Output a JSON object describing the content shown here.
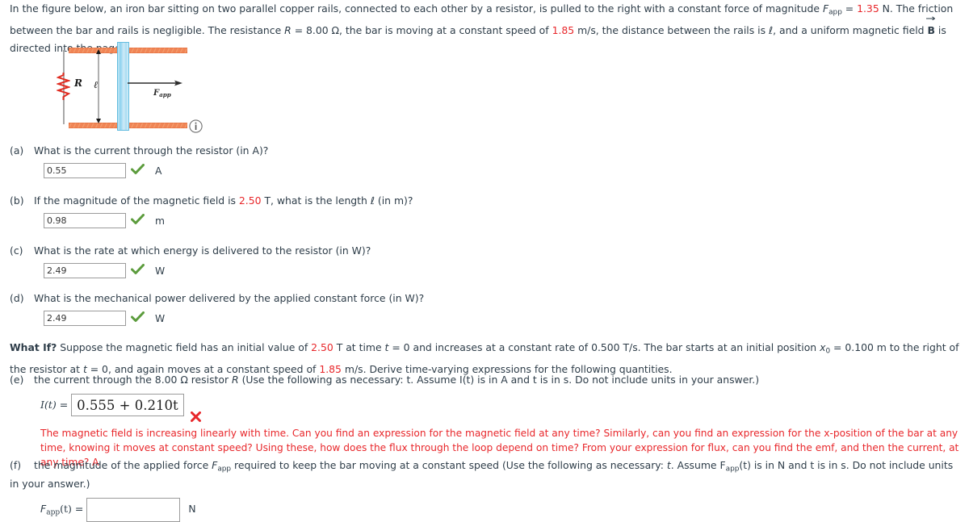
{
  "problem": {
    "intro_part1": "In the figure below, an iron bar sitting on two parallel copper rails, connected to each other by a resistor, is pulled to the right with a constant force of magnitude ",
    "intro_fapp_symbol": "F",
    "intro_fapp_sub": "app",
    "intro_eq": " = ",
    "force_value": "1.35",
    "intro_part2": " N. The friction between the bar and rails is negligible. The resistance ",
    "resistance_symbol": "R",
    "resistance_value": " = 8.00 Ω",
    "intro_part3": ", the bar is moving at a constant speed of ",
    "speed_value": "1.85",
    "intro_part4": " m/s, the distance between the rails is ",
    "ell_symbol": "ℓ",
    "intro_part5": ", and a uniform magnetic field ",
    "field_symbol": "B",
    "intro_part6": " is directed into the page."
  },
  "figure": {
    "resistor_label": "R",
    "length_label": "ℓ",
    "force_label_symbol": "F",
    "force_label_sub": "app",
    "info_icon_label": "i",
    "rail_color": "#ef7f4e",
    "bar_color": "#8fd3ef",
    "resistor_color": "#e02b20",
    "wire_color": "#9e9e9e"
  },
  "questions": [
    {
      "tag": "(a)",
      "text": "What is the current through the resistor (in A)?",
      "value": "0.55",
      "unit": "A",
      "status": "correct"
    },
    {
      "tag": "(b)",
      "text_pre": "If the magnitude of the magnetic field is ",
      "highlight": "2.50",
      "text_post": " T, what is the length ℓ (in m)?",
      "value": "0.98",
      "unit": "m",
      "status": "correct"
    },
    {
      "tag": "(c)",
      "text": "What is the rate at which energy is delivered to the resistor (in W)?",
      "value": "2.49",
      "unit": "W",
      "status": "correct"
    },
    {
      "tag": "(d)",
      "text": "What is the mechanical power delivered by the applied constant force (in W)?",
      "value": "2.49",
      "unit": "W",
      "status": "correct"
    }
  ],
  "what_if": {
    "label": "What If?",
    "part1": " Suppose the magnetic field has an initial value of ",
    "field_initial": "2.50",
    "part2": " T at time ",
    "t_symbol": "t",
    "part3": " = 0 and increases at a constant rate of 0.500 T/s. The bar starts at an initial position ",
    "x0_symbol": "x",
    "x0_sub": "0",
    "part4": " = 0.100 m to the right of the resistor at ",
    "part5": " = 0, and again moves at a constant speed of ",
    "speed": "1.85",
    "part6": " m/s. Derive time-varying expressions for the following quantities."
  },
  "part_e": {
    "tag": "(e)",
    "text_pre": "the current through the 8.00 Ω resistor ",
    "resistor_symbol": "R",
    "text_post": " (Use the following as necessary: t. Assume I(t) is in A and t is in s. Do not include units in your answer.)",
    "lhs": "I(t) =",
    "answer": "0.555 + 0.210t",
    "status": "incorrect",
    "feedback": "The magnetic field is increasing linearly with time. Can you find an expression for the magnetic field at any time? Similarly, can you find an expression for the x-position of the bar at any time, knowing it moves at constant speed? Using these, how does the flux through the loop depend on time? From your expression for flux, can you find the emf, and then the current, at any time? A"
  },
  "part_f": {
    "tag": "(f)",
    "text_pre": "the magnitude of the applied force ",
    "f_symbol": "F",
    "f_sub": "app",
    "text_mid": " required to keep the bar moving at a constant speed (Use the following as necessary: ",
    "t_symbol": "t",
    "text_post": ". Assume F",
    "text_post2": "(t) is in N and t is in s. Do not include units in your answer.)",
    "lhs_symbol": "F",
    "lhs_sub": "app",
    "lhs_rest": "(t) =",
    "answer": "",
    "unit": "N"
  },
  "colors": {
    "text": "#2e3d49",
    "highlight_red": "#e8272b",
    "check_green": "#5c9c3d",
    "x_red": "#e8272b",
    "box_border": "#9b9b9b"
  }
}
